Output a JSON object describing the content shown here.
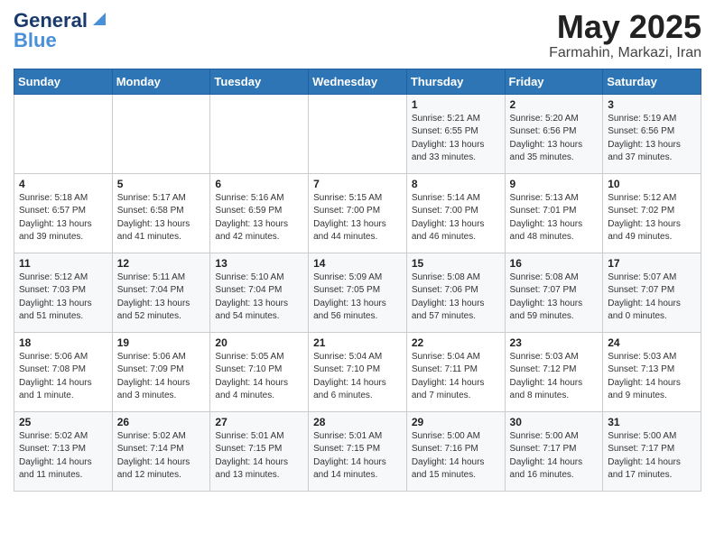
{
  "header": {
    "logo_line1": "General",
    "logo_line2": "Blue",
    "month_year": "May 2025",
    "location": "Farmahin, Markazi, Iran"
  },
  "weekdays": [
    "Sunday",
    "Monday",
    "Tuesday",
    "Wednesday",
    "Thursday",
    "Friday",
    "Saturday"
  ],
  "weeks": [
    [
      {
        "day": "",
        "content": ""
      },
      {
        "day": "",
        "content": ""
      },
      {
        "day": "",
        "content": ""
      },
      {
        "day": "",
        "content": ""
      },
      {
        "day": "1",
        "content": "Sunrise: 5:21 AM\nSunset: 6:55 PM\nDaylight: 13 hours\nand 33 minutes."
      },
      {
        "day": "2",
        "content": "Sunrise: 5:20 AM\nSunset: 6:56 PM\nDaylight: 13 hours\nand 35 minutes."
      },
      {
        "day": "3",
        "content": "Sunrise: 5:19 AM\nSunset: 6:56 PM\nDaylight: 13 hours\nand 37 minutes."
      }
    ],
    [
      {
        "day": "4",
        "content": "Sunrise: 5:18 AM\nSunset: 6:57 PM\nDaylight: 13 hours\nand 39 minutes."
      },
      {
        "day": "5",
        "content": "Sunrise: 5:17 AM\nSunset: 6:58 PM\nDaylight: 13 hours\nand 41 minutes."
      },
      {
        "day": "6",
        "content": "Sunrise: 5:16 AM\nSunset: 6:59 PM\nDaylight: 13 hours\nand 42 minutes."
      },
      {
        "day": "7",
        "content": "Sunrise: 5:15 AM\nSunset: 7:00 PM\nDaylight: 13 hours\nand 44 minutes."
      },
      {
        "day": "8",
        "content": "Sunrise: 5:14 AM\nSunset: 7:00 PM\nDaylight: 13 hours\nand 46 minutes."
      },
      {
        "day": "9",
        "content": "Sunrise: 5:13 AM\nSunset: 7:01 PM\nDaylight: 13 hours\nand 48 minutes."
      },
      {
        "day": "10",
        "content": "Sunrise: 5:12 AM\nSunset: 7:02 PM\nDaylight: 13 hours\nand 49 minutes."
      }
    ],
    [
      {
        "day": "11",
        "content": "Sunrise: 5:12 AM\nSunset: 7:03 PM\nDaylight: 13 hours\nand 51 minutes."
      },
      {
        "day": "12",
        "content": "Sunrise: 5:11 AM\nSunset: 7:04 PM\nDaylight: 13 hours\nand 52 minutes."
      },
      {
        "day": "13",
        "content": "Sunrise: 5:10 AM\nSunset: 7:04 PM\nDaylight: 13 hours\nand 54 minutes."
      },
      {
        "day": "14",
        "content": "Sunrise: 5:09 AM\nSunset: 7:05 PM\nDaylight: 13 hours\nand 56 minutes."
      },
      {
        "day": "15",
        "content": "Sunrise: 5:08 AM\nSunset: 7:06 PM\nDaylight: 13 hours\nand 57 minutes."
      },
      {
        "day": "16",
        "content": "Sunrise: 5:08 AM\nSunset: 7:07 PM\nDaylight: 13 hours\nand 59 minutes."
      },
      {
        "day": "17",
        "content": "Sunrise: 5:07 AM\nSunset: 7:07 PM\nDaylight: 14 hours\nand 0 minutes."
      }
    ],
    [
      {
        "day": "18",
        "content": "Sunrise: 5:06 AM\nSunset: 7:08 PM\nDaylight: 14 hours\nand 1 minute."
      },
      {
        "day": "19",
        "content": "Sunrise: 5:06 AM\nSunset: 7:09 PM\nDaylight: 14 hours\nand 3 minutes."
      },
      {
        "day": "20",
        "content": "Sunrise: 5:05 AM\nSunset: 7:10 PM\nDaylight: 14 hours\nand 4 minutes."
      },
      {
        "day": "21",
        "content": "Sunrise: 5:04 AM\nSunset: 7:10 PM\nDaylight: 14 hours\nand 6 minutes."
      },
      {
        "day": "22",
        "content": "Sunrise: 5:04 AM\nSunset: 7:11 PM\nDaylight: 14 hours\nand 7 minutes."
      },
      {
        "day": "23",
        "content": "Sunrise: 5:03 AM\nSunset: 7:12 PM\nDaylight: 14 hours\nand 8 minutes."
      },
      {
        "day": "24",
        "content": "Sunrise: 5:03 AM\nSunset: 7:13 PM\nDaylight: 14 hours\nand 9 minutes."
      }
    ],
    [
      {
        "day": "25",
        "content": "Sunrise: 5:02 AM\nSunset: 7:13 PM\nDaylight: 14 hours\nand 11 minutes."
      },
      {
        "day": "26",
        "content": "Sunrise: 5:02 AM\nSunset: 7:14 PM\nDaylight: 14 hours\nand 12 minutes."
      },
      {
        "day": "27",
        "content": "Sunrise: 5:01 AM\nSunset: 7:15 PM\nDaylight: 14 hours\nand 13 minutes."
      },
      {
        "day": "28",
        "content": "Sunrise: 5:01 AM\nSunset: 7:15 PM\nDaylight: 14 hours\nand 14 minutes."
      },
      {
        "day": "29",
        "content": "Sunrise: 5:00 AM\nSunset: 7:16 PM\nDaylight: 14 hours\nand 15 minutes."
      },
      {
        "day": "30",
        "content": "Sunrise: 5:00 AM\nSunset: 7:17 PM\nDaylight: 14 hours\nand 16 minutes."
      },
      {
        "day": "31",
        "content": "Sunrise: 5:00 AM\nSunset: 7:17 PM\nDaylight: 14 hours\nand 17 minutes."
      }
    ]
  ]
}
